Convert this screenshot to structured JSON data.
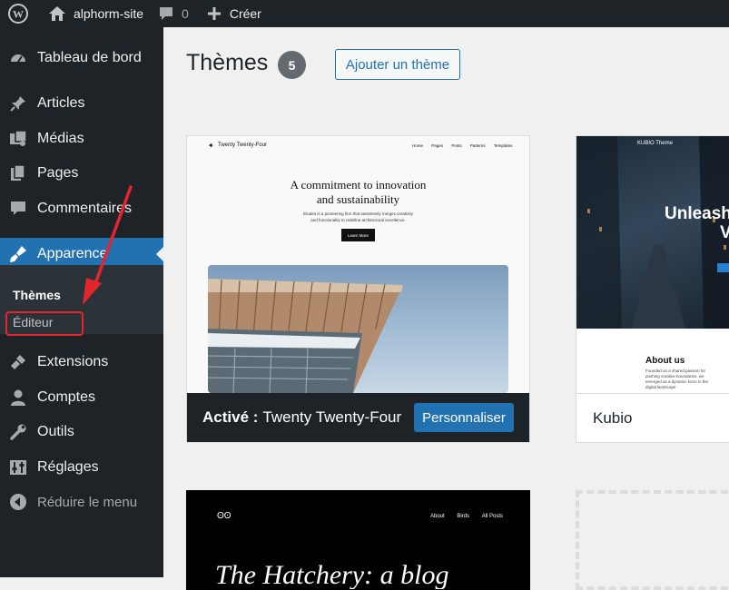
{
  "adminbar": {
    "site_name": "alphorm-site",
    "comments_count": "0",
    "new_label": "Créer"
  },
  "sidebar": {
    "items": [
      {
        "label": "Tableau de bord",
        "icon": "dashboard-icon"
      },
      {
        "label": "Articles",
        "icon": "pin-icon"
      },
      {
        "label": "Médias",
        "icon": "media-icon"
      },
      {
        "label": "Pages",
        "icon": "pages-icon"
      },
      {
        "label": "Commentaires",
        "icon": "comment-icon"
      },
      {
        "label": "Apparence",
        "icon": "brush-icon"
      },
      {
        "label": "Extensions",
        "icon": "plugin-icon"
      },
      {
        "label": "Comptes",
        "icon": "user-icon"
      },
      {
        "label": "Outils",
        "icon": "wrench-icon"
      },
      {
        "label": "Réglages",
        "icon": "settings-icon"
      }
    ],
    "submenu": {
      "themes": "Thèmes",
      "editor": "Éditeur"
    },
    "collapse_label": "Réduire le menu"
  },
  "main": {
    "title": "Thèmes",
    "theme_count": "5",
    "add_button": "Ajouter un thème"
  },
  "themes": [
    {
      "active_prefix": "Activé :",
      "name": "Twenty Twenty-Four",
      "customize_label": "Personnaliser",
      "preview": {
        "brand": "Twenty Twenty-Four",
        "nav": [
          "Home",
          "Pages",
          "Posts",
          "Patterns",
          "Templates"
        ],
        "headline_1": "A commitment to innovation",
        "headline_2": "and sustainability",
        "intro_1": "Études is a pioneering firm that seamlessly merges creativity",
        "intro_2": "and functionality to redefine architectural excellence.",
        "cta": "Learn More"
      }
    },
    {
      "name": "Kubio",
      "preview": {
        "brand": "KUBIO Theme",
        "hero_1": "Unleash",
        "hero_2": "V",
        "about_title": "About us",
        "about_1": "Founded on a shared passion for",
        "about_2": "pushing creative boundaries, we",
        "about_3": "emerged as a dynamic force in the",
        "about_4": "digital landscape"
      }
    },
    {
      "preview": {
        "nav": [
          "About",
          "Birds",
          "All Posts"
        ],
        "hero": "The Hatchery: a blog"
      }
    }
  ],
  "colors": {
    "accent": "#2271b1",
    "dark": "#1d2327",
    "highlight": "#e3262d"
  }
}
